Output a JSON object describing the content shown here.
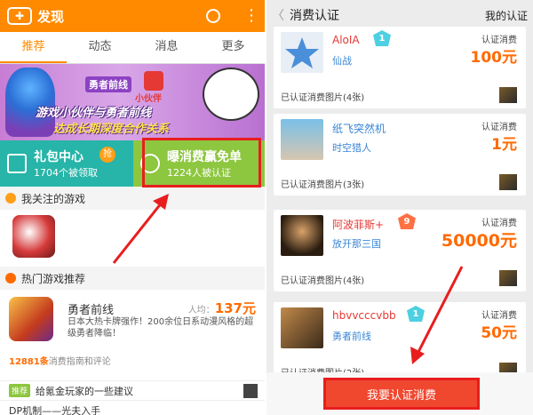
{
  "left": {
    "app_title": "发现",
    "icons": {
      "logo": "gamepad-icon",
      "search": "search-icon",
      "more": "more-vertical-icon"
    },
    "tabs": [
      "推荐",
      "动态",
      "消息",
      "更多"
    ],
    "banner": {
      "logo_text_1": "勇者前线",
      "logo_text_2": "小伙伴",
      "headline_1": "游戏小伙伴与勇者前线",
      "headline_2": "达成长期深度合作关系"
    },
    "promo_gift": {
      "title": "礼包中心",
      "badge": "抢",
      "sub": "1704个被领取"
    },
    "promo_receipt": {
      "title": "曝消费赢免单",
      "sub": "1224人被认证"
    },
    "section_followed": "我关注的游戏",
    "section_hot": "热门游戏推荐",
    "hot_game": {
      "name": "勇者前线",
      "avg_label": "人均：",
      "avg_value": "137元",
      "desc": "日本大热卡牌强作！200余位日系动漫风格的超级勇者降临！",
      "count": "12881条",
      "count_suffix": "消费指南和评论"
    },
    "tips": [
      {
        "tag": "推荐",
        "text": "给氪金玩家的一些建议"
      },
      {
        "tag": "",
        "text": "DP机制——光夫入手"
      }
    ]
  },
  "right": {
    "title": "消费认证",
    "my_certification": "我的认证",
    "cards": [
      {
        "user": "AloIA",
        "level": "1",
        "game": "仙战",
        "label": "认证消费",
        "amount": "100元",
        "images": "已认证消费图片(4张)"
      },
      {
        "user": "纸飞突然机",
        "level": "",
        "game": "时空猎人",
        "label": "认证消费",
        "amount": "1元",
        "images": "已认证消费图片(3张)"
      },
      {
        "user": "阿波菲斯+",
        "level": "9",
        "game": "放开那三国",
        "label": "认证消费",
        "amount": "50000元",
        "images": "已认证消费图片(4张)"
      },
      {
        "user": "hbvvcccvbb",
        "level": "1",
        "game": "勇者前线",
        "label": "认证消费",
        "amount": "50元",
        "images": "已认证消费图片(2张)"
      }
    ],
    "apply_button": "我要认证消费"
  },
  "colors": {
    "accent": "#ff8a00",
    "price": "#ff6a00",
    "highlight": "#e81e1e",
    "teal": "#26b5a8",
    "green": "#8dc63f"
  }
}
